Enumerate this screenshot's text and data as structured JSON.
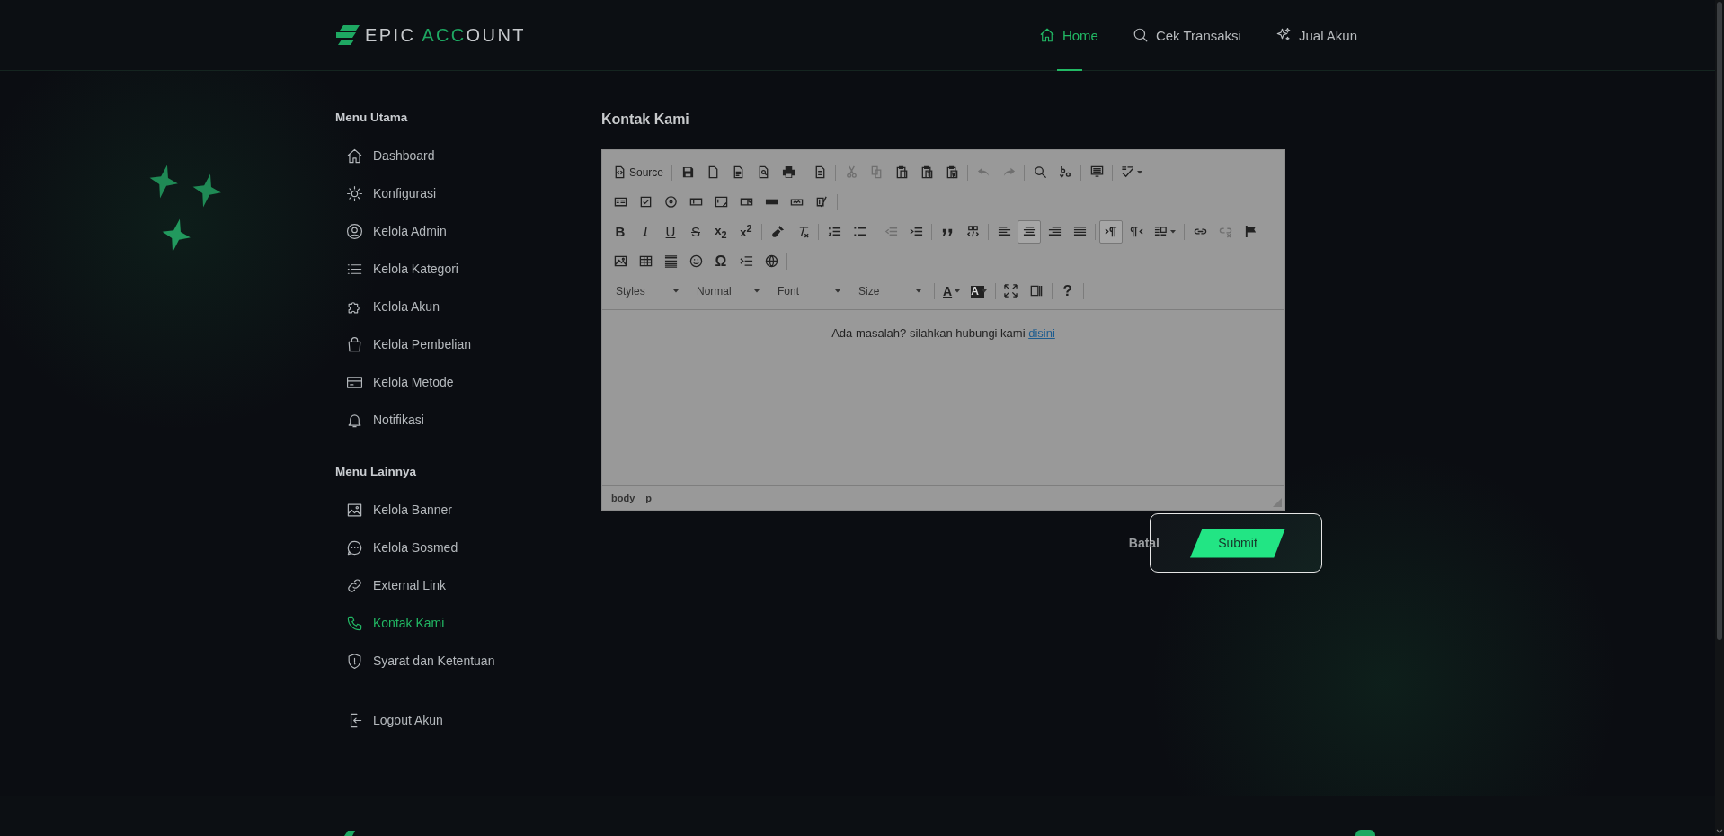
{
  "header": {
    "logo_parts": [
      {
        "text": "EPIC ",
        "accent": false
      },
      {
        "text": "ACC",
        "accent": true
      },
      {
        "text": "OUNT",
        "accent": false
      }
    ],
    "nav": [
      {
        "label": "Home",
        "selected": true
      },
      {
        "label": "Cek Transaksi",
        "selected": false
      },
      {
        "label": "Jual Akun",
        "selected": false
      }
    ]
  },
  "sidebar": {
    "sections": [
      {
        "title": "Menu Utama",
        "items": [
          {
            "label": "Dashboard",
            "selected": false
          },
          {
            "label": "Konfigurasi",
            "selected": false
          },
          {
            "label": "Kelola Admin",
            "selected": false
          },
          {
            "label": "Kelola Kategori",
            "selected": false
          },
          {
            "label": "Kelola Akun",
            "selected": false
          },
          {
            "label": "Kelola Pembelian",
            "selected": false
          },
          {
            "label": "Kelola Metode",
            "selected": false
          },
          {
            "label": "Notifikasi",
            "selected": false
          }
        ]
      },
      {
        "title": "Menu Lainnya",
        "items": [
          {
            "label": "Kelola Banner",
            "selected": false
          },
          {
            "label": "Kelola Sosmed",
            "selected": false
          },
          {
            "label": "External Link",
            "selected": false
          },
          {
            "label": "Kontak Kami",
            "selected": true
          },
          {
            "label": "Syarat dan Ketentuan",
            "selected": false
          }
        ]
      }
    ],
    "logout": "Logout Akun"
  },
  "page_title": "Kontak Kami",
  "editor": {
    "toolbar": [
      [
        [
          {
            "kind": "icon_label",
            "label": "Source",
            "disabled": false,
            "selected": false
          }
        ],
        [
          {
            "kind": "icon",
            "disabled": false,
            "selected": false
          },
          {
            "kind": "icon",
            "disabled": false,
            "selected": false
          },
          {
            "kind": "icon",
            "disabled": false,
            "selected": false
          },
          {
            "kind": "icon",
            "disabled": false,
            "selected": false
          },
          {
            "kind": "icon",
            "disabled": false,
            "selected": false
          }
        ],
        [
          {
            "kind": "icon",
            "disabled": false,
            "selected": false
          }
        ],
        [
          {
            "kind": "icon",
            "disabled": true,
            "selected": false
          },
          {
            "kind": "icon",
            "disabled": true,
            "selected": false
          },
          {
            "kind": "icon",
            "disabled": false,
            "selected": false
          },
          {
            "kind": "icon",
            "disabled": false,
            "selected": false
          },
          {
            "kind": "icon",
            "disabled": false,
            "selected": false
          }
        ],
        [
          {
            "kind": "icon",
            "disabled": true,
            "selected": false
          },
          {
            "kind": "icon",
            "disabled": true,
            "selected": false
          }
        ],
        [
          {
            "kind": "icon",
            "disabled": false,
            "selected": false
          },
          {
            "kind": "icon",
            "disabled": false,
            "selected": false
          }
        ],
        [
          {
            "kind": "icon",
            "disabled": false,
            "selected": false
          }
        ],
        [
          {
            "kind": "icon_dropdown",
            "disabled": false,
            "selected": false
          }
        ]
      ],
      [
        [
          {
            "kind": "icon",
            "disabled": false,
            "selected": false
          },
          {
            "kind": "icon",
            "disabled": false,
            "selected": false
          },
          {
            "kind": "icon",
            "disabled": false,
            "selected": false
          },
          {
            "kind": "icon",
            "disabled": false,
            "selected": false
          },
          {
            "kind": "icon",
            "disabled": false,
            "selected": false
          },
          {
            "kind": "icon",
            "disabled": false,
            "selected": false
          },
          {
            "kind": "icon",
            "disabled": false,
            "selected": false
          },
          {
            "kind": "icon",
            "disabled": false,
            "selected": false
          },
          {
            "kind": "icon",
            "disabled": false,
            "selected": false
          }
        ]
      ],
      [
        [
          {
            "kind": "bold",
            "label": "B",
            "disabled": false,
            "selected": false
          },
          {
            "kind": "italic",
            "label": "I",
            "disabled": false,
            "selected": false
          },
          {
            "kind": "underline",
            "label": "U",
            "disabled": false,
            "selected": false
          },
          {
            "kind": "strike",
            "label": "S",
            "disabled": false,
            "selected": false
          },
          {
            "kind": "script",
            "label": "x$_{2}$",
            "disabled": false,
            "selected": false
          },
          {
            "kind": "script",
            "label": "x$^{2}$",
            "disabled": false,
            "selected": false
          }
        ],
        [
          {
            "kind": "icon",
            "disabled": false,
            "selected": false
          },
          {
            "kind": "icon",
            "disabled": false,
            "selected": false
          }
        ],
        [
          {
            "kind": "icon",
            "disabled": false,
            "selected": false
          },
          {
            "kind": "icon",
            "disabled": false,
            "selected": false
          }
        ],
        [
          {
            "kind": "icon",
            "disabled": true,
            "selected": false
          },
          {
            "kind": "icon",
            "disabled": false,
            "selected": false
          }
        ],
        [
          {
            "kind": "icon",
            "disabled": false,
            "selected": false
          },
          {
            "kind": "icon",
            "disabled": false,
            "selected": false
          }
        ],
        [
          {
            "kind": "icon",
            "disabled": false,
            "selected": false
          },
          {
            "kind": "icon",
            "disabled": false,
            "selected": true
          },
          {
            "kind": "icon",
            "disabled": false,
            "selected": false
          },
          {
            "kind": "icon",
            "disabled": false,
            "selected": false
          }
        ],
        [
          {
            "kind": "icon",
            "disabled": false,
            "selected": true
          },
          {
            "kind": "icon",
            "disabled": false,
            "selected": false
          },
          {
            "kind": "icon_dropdown",
            "disabled": false,
            "selected": false
          }
        ],
        [
          {
            "kind": "icon",
            "disabled": false,
            "selected": false
          },
          {
            "kind": "icon",
            "disabled": true,
            "selected": false
          },
          {
            "kind": "icon",
            "disabled": false,
            "selected": false
          }
        ]
      ],
      [
        [
          {
            "kind": "icon",
            "disabled": false,
            "selected": false
          },
          {
            "kind": "icon",
            "disabled": false,
            "selected": false
          },
          {
            "kind": "icon",
            "disabled": false,
            "selected": false
          },
          {
            "kind": "icon",
            "disabled": false,
            "selected": false
          },
          {
            "kind": "glyph",
            "label": "Ω",
            "disabled": false,
            "selected": false
          },
          {
            "kind": "icon",
            "disabled": false,
            "selected": false
          },
          {
            "kind": "icon",
            "disabled": false,
            "selected": false
          }
        ]
      ],
      [
        [
          {
            "kind": "combo",
            "label": "Styles"
          },
          {
            "kind": "combo",
            "label": "Normal"
          },
          {
            "kind": "combo",
            "label": "Font"
          },
          {
            "kind": "combo",
            "label": "Size"
          }
        ],
        [
          {
            "kind": "text_color",
            "label": "A",
            "disabled": false,
            "selected": false
          },
          {
            "kind": "bg_color",
            "label": "A",
            "disabled": false,
            "selected": false
          }
        ],
        [
          {
            "kind": "icon",
            "disabled": false,
            "selected": false
          },
          {
            "kind": "icon",
            "disabled": false,
            "selected": false
          }
        ],
        [
          {
            "kind": "help",
            "label": "?",
            "disabled": false,
            "selected": false
          }
        ]
      ]
    ],
    "content": {
      "text": "Ada masalah? silahkan hubungi kami",
      "link": "disini"
    },
    "path": [
      "body",
      "p"
    ]
  },
  "actions": {
    "cancel": "Batal",
    "submit": "Submit"
  }
}
